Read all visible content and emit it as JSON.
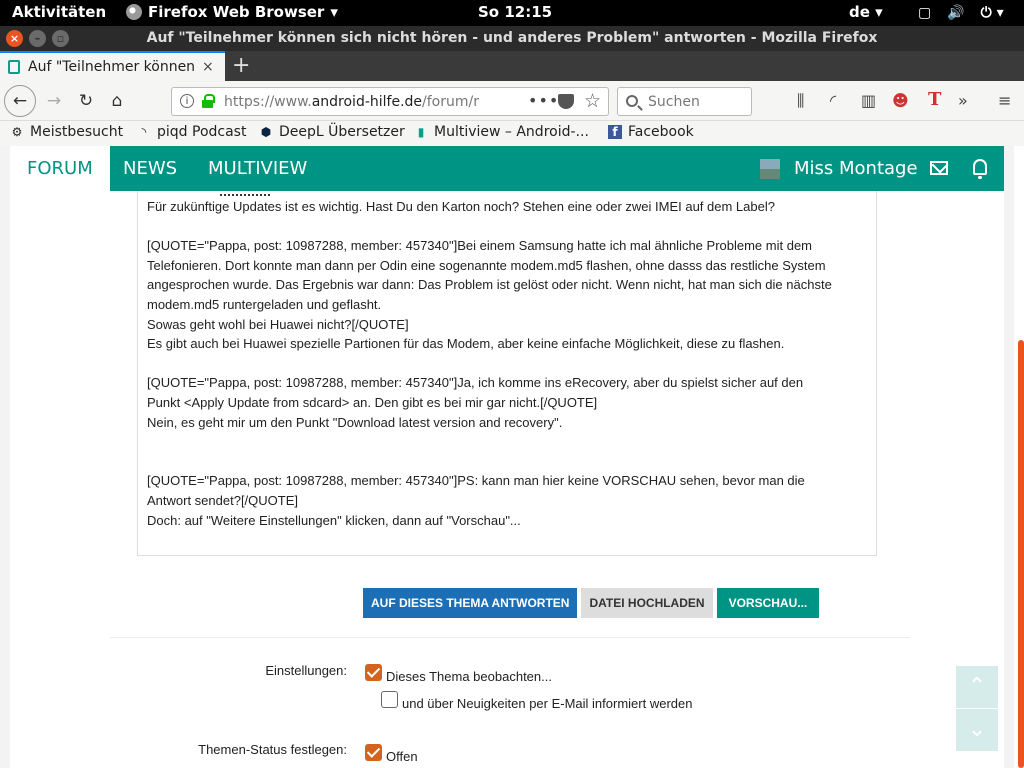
{
  "topbar": {
    "activities": "Aktivitäten",
    "app_name": "Firefox Web Browser",
    "clock": "So 12:15",
    "lang": "de"
  },
  "window": {
    "title": "Auf \"Teilnehmer können sich nicht hören - und anderes Problem\" antworten - Mozilla Firefox"
  },
  "tab": {
    "label": "Auf \"Teilnehmer können",
    "close": "×",
    "new_tab": "+"
  },
  "navbar": {
    "url_prefix": "https://www.",
    "url_domain": "android-hilfe.de",
    "url_path": "/forum/r",
    "search_placeholder": "Suchen"
  },
  "bookmarks": [
    {
      "label": "Meistbesucht",
      "icon": "gear-icon"
    },
    {
      "label": "piqd Podcast",
      "icon": "rss-icon"
    },
    {
      "label": "DeepL Übersetzer",
      "icon": "deepl-icon"
    },
    {
      "label": "Multiview – Android-...",
      "icon": "android-hilfe-icon"
    },
    {
      "label": "Facebook",
      "icon": "facebook-icon"
    }
  ],
  "site_nav": {
    "items": [
      "FORUM",
      "NEWS",
      "MULTIVIEW"
    ],
    "user": "Miss Montage"
  },
  "editor": {
    "lines": [
      "Für zukünftige Updates ist es wichtig. Hast Du den Karton noch? Stehen eine oder zwei IMEI auf dem Label?",
      "",
      "[QUOTE=\"Pappa, post: 10987288, member: 457340\"]Bei einem Samsung hatte ich mal ähnliche Probleme mit dem",
      "Telefonieren. Dort konnte man dann per Odin eine sogenannte modem.md5 flashen, ohne dasss das restliche System",
      "angesprochen wurde. Das Ergebnis war dann: Das Problem ist gelöst oder nicht. Wenn nicht, hat man sich die nächste",
      "modem.md5 runtergeladen und geflasht.",
      "Sowas geht wohl bei Huawei nicht?[/QUOTE]",
      "Es gibt auch bei Huawei spezielle Partionen für das Modem, aber keine einfache Möglichkeit, diese zu flashen.",
      "",
      "[QUOTE=\"Pappa, post: 10987288, member: 457340\"]Ja, ich komme ins eRecovery, aber du spielst sicher auf den",
      "Punkt <Apply Update from sdcard> an. Den gibt es bei mir gar nicht.[/QUOTE]",
      "Nein, es geht mir um den Punkt \"Download latest version and recovery\".",
      "",
      "",
      "[QUOTE=\"Pappa, post: 10987288, member: 457340\"]PS: kann man hier keine VORSCHAU sehen, bevor man die",
      "Antwort sendet?[/QUOTE]",
      "Doch: auf \"Weitere Einstellungen\" klicken, dann auf \"Vorschau\"..."
    ]
  },
  "buttons": {
    "reply": "AUF DIESES THEMA ANTWORTEN",
    "upload": "DATEI HOCHLADEN",
    "preview": "VORSCHAU..."
  },
  "options": {
    "settings_label": "Einstellungen:",
    "watch_label": "Dieses Thema beobachten...",
    "watch_checked": true,
    "email_label": "und über Neuigkeiten per E-Mail informiert werden",
    "email_checked": false,
    "status_label": "Themen-Status festlegen:",
    "open_label": "Offen",
    "open_checked": true
  },
  "colors": {
    "brand": "#009485",
    "primary_button": "#1c6fb5",
    "checkbox": "#d4631f",
    "ubuntu_orange": "#e95420"
  }
}
